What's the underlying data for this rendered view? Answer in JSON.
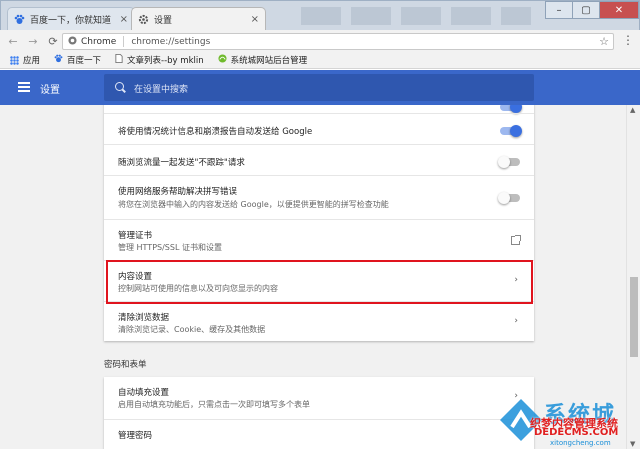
{
  "tabs": [
    {
      "title": "百度一下，你就知道",
      "close": "×",
      "favicon": "baidu-paw-icon"
    },
    {
      "title": "设置",
      "close": "×",
      "favicon": "gear-icon"
    }
  ],
  "window_controls": {
    "minimize": "–",
    "maximize": "▢",
    "close": "✕"
  },
  "toolbar": {
    "back": "←",
    "forward": "→",
    "reload": "⟳",
    "site_label": "Chrome",
    "url": "chrome://settings",
    "star": "☆",
    "menu": "⋮"
  },
  "bookmarks": [
    {
      "label": "应用",
      "icon": "apps-grid-icon"
    },
    {
      "label": "百度一下",
      "icon": "baidu-paw-icon"
    },
    {
      "label": "文章列表--by mklin",
      "icon": "page-icon"
    },
    {
      "label": "系统城网站后台管理",
      "icon": "site-icon"
    }
  ],
  "header": {
    "title": "设置",
    "search_placeholder": "在设置中搜索"
  },
  "privacy_rows": [
    {
      "title": "将使用情况统计信息和崩溃报告自动发送给 Google",
      "control": "toggle",
      "on": true
    },
    {
      "title": "随浏览流量一起发送\"不跟踪\"请求",
      "control": "toggle",
      "on": false
    },
    {
      "title": "使用网络服务帮助解决拼写错误",
      "sub": "将您在浏览器中输入的内容发送给 Google，以便提供更智能的拼写检查功能",
      "control": "toggle",
      "on": false
    },
    {
      "title": "管理证书",
      "sub": "管理 HTTPS/SSL 证书和设置",
      "control": "external-link"
    },
    {
      "title": "内容设置",
      "sub": "控制网站可使用的信息以及可向您显示的内容",
      "control": "arrow",
      "highlighted": true
    },
    {
      "title": "清除浏览数据",
      "sub": "清除浏览记录、Cookie、缓存及其他数据",
      "control": "arrow"
    }
  ],
  "arrow_glyph": "›",
  "section_passwords": "密码和表单",
  "password_rows": [
    {
      "title": "自动填充设置",
      "sub": "启用自动填充功能后，只需点击一次即可填写多个表单",
      "control": "arrow"
    },
    {
      "title": "管理密码",
      "sub": ""
    }
  ],
  "watermark": {
    "brand": "系统城",
    "line1": "织梦内容管理系统",
    "line2": "DEDECMS.COM",
    "domain": "xitongcheng.com"
  },
  "colors": {
    "header_blue": "#3a67c9",
    "toggle_on": "#3a6fe0",
    "highlight_red": "#e0141e"
  }
}
